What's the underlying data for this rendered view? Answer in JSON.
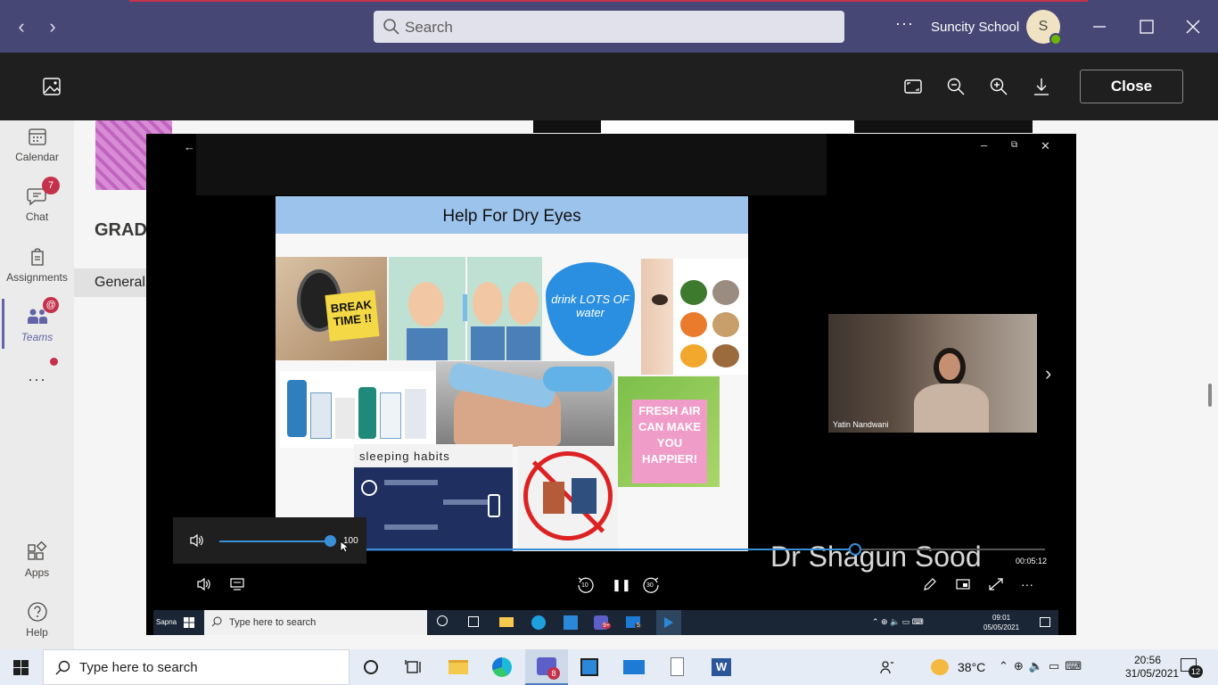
{
  "teams_titlebar": {
    "search_placeholder": "Search",
    "more_label": "···",
    "org_name": "Suncity School",
    "avatar_initial": "S"
  },
  "viewer": {
    "close_label": "Close"
  },
  "rail": {
    "items": [
      {
        "label": "Calendar",
        "icon": "calendar-icon"
      },
      {
        "label": "Chat",
        "icon": "chat-icon",
        "badge": "7"
      },
      {
        "label": "Assignments",
        "icon": "assignments-icon"
      },
      {
        "label": "Teams",
        "icon": "teams-icon",
        "badge": "@"
      },
      {
        "label": "···",
        "icon": "more-icon"
      }
    ],
    "bottom_items": [
      {
        "label": "Apps",
        "icon": "apps-icon"
      },
      {
        "label": "Help",
        "icon": "help-icon"
      }
    ]
  },
  "background": {
    "team_heading": "GRAD",
    "channel": "General"
  },
  "player": {
    "slide_title": "Help For Dry Eyes",
    "tile_texts": {
      "break": "BREAK TIME !!",
      "drink": "drink LOTS OF water",
      "fresh_air": "FRESH AIR CAN MAKE YOU HAPPIER!",
      "sleeping": "sleeping habits"
    },
    "camera_name": "Yatin Nandwani",
    "presenter_name": "Dr Shagun Sood",
    "timecode": "00:05:12",
    "volume_value": "100",
    "volume_fraction": 1.0,
    "progress_fraction": 0.72,
    "skip_back": "10",
    "skip_forward": "30"
  },
  "inner_taskbar": {
    "user": "Sapna",
    "search_placeholder": "Type here to search",
    "mail_badge": "5",
    "teams_badge": "9+",
    "time": "09:01",
    "date": "05/05/2021"
  },
  "taskbar": {
    "search_placeholder": "Type here to search",
    "teams_badge": "8",
    "temperature": "38°C",
    "time": "20:56",
    "date": "31/05/2021",
    "notifications": "12"
  }
}
